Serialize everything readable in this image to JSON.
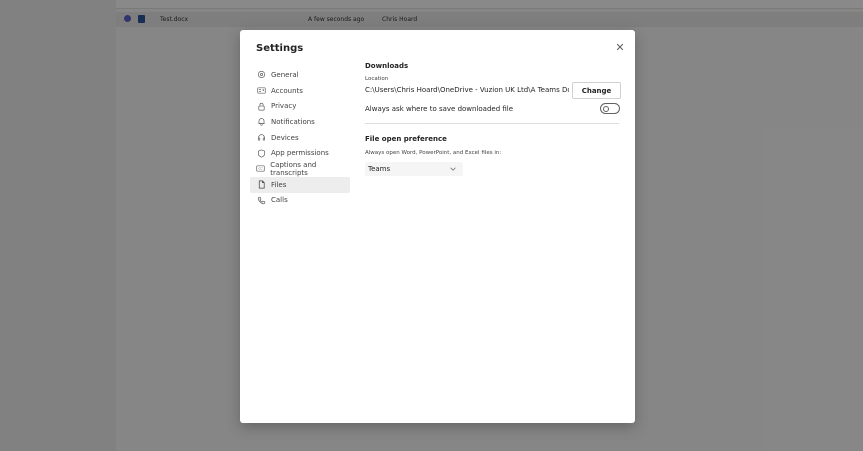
{
  "background": {
    "file_name": "Test.docx",
    "modified": "A few seconds ago",
    "modified_by": "Chris Hoard"
  },
  "dialog": {
    "title": "Settings",
    "close_icon": "close-icon"
  },
  "nav": {
    "items": [
      {
        "label": "General",
        "icon": "gear-icon"
      },
      {
        "label": "Accounts",
        "icon": "id-card-icon"
      },
      {
        "label": "Privacy",
        "icon": "lock-icon"
      },
      {
        "label": "Notifications",
        "icon": "bell-icon"
      },
      {
        "label": "Devices",
        "icon": "headset-icon"
      },
      {
        "label": "App permissions",
        "icon": "shield-icon"
      },
      {
        "label": "Captions and transcripts",
        "icon": "closed-caption-icon"
      },
      {
        "label": "Files",
        "icon": "file-icon"
      },
      {
        "label": "Calls",
        "icon": "phone-icon"
      }
    ],
    "active": "Files"
  },
  "downloads": {
    "title": "Downloads",
    "location_label": "Location",
    "path": "C:\\Users\\Chris Hoard\\OneDrive - Vuzion UK Ltd\\A Teams Download",
    "change_label": "Change",
    "ask_label": "Always ask where to save downloaded file",
    "ask_enabled": false
  },
  "file_open": {
    "title": "File open preference",
    "description": "Always open Word, PowerPoint, and Excel files in:",
    "selected": "Teams"
  },
  "colors": {
    "accent": "#5b5fc7",
    "active_nav_bg": "#ededed",
    "overlay": "#000000"
  }
}
